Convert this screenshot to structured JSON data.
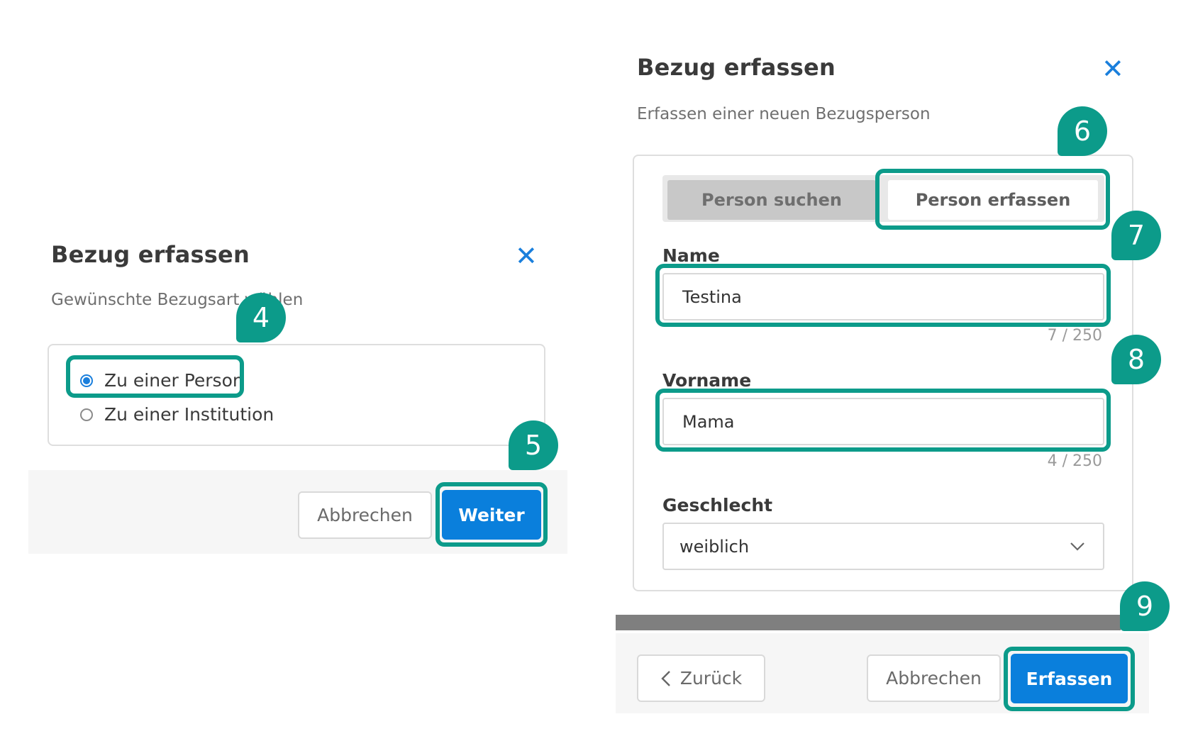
{
  "dialog_left": {
    "title": "Bezug erfassen",
    "subtitle": "Gewünschte Bezugsart wählen",
    "options": [
      {
        "label": "Zu einer Person",
        "selected": true
      },
      {
        "label": "Zu einer Institution",
        "selected": false
      }
    ],
    "cancel_label": "Abbrechen",
    "next_label": "Weiter"
  },
  "dialog_right": {
    "title": "Bezug erfassen",
    "subtitle": "Erfassen einer neuen Bezugsperson",
    "tabs": [
      {
        "label": "Person suchen",
        "active": false
      },
      {
        "label": "Person erfassen",
        "active": true
      }
    ],
    "name": {
      "label": "Name",
      "value": "Testina",
      "counter": "7 / 250"
    },
    "firstname": {
      "label": "Vorname",
      "value": "Mama",
      "counter": "4 / 250"
    },
    "gender": {
      "label": "Geschlecht",
      "value": "weiblich"
    },
    "back_label": "Zurück",
    "cancel_label": "Abbrechen",
    "submit_label": "Erfassen"
  },
  "steps": [
    "4",
    "5",
    "6",
    "7",
    "8",
    "9"
  ],
  "icons": {
    "close": "✕",
    "chevron_left": "‹",
    "chevron_down": "⌄"
  },
  "colors": {
    "accent": "#0a7fdc",
    "highlight": "#0c9b8a"
  }
}
